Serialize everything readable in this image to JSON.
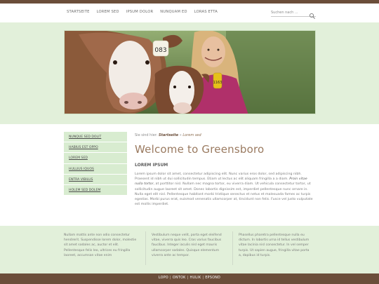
{
  "nav": {
    "items": [
      "STARTSEITE",
      "LOREM SED",
      "IPSUM DOLOR",
      "NUNQUAM ED",
      "LORAS ETTA"
    ]
  },
  "search": {
    "placeholder": "Suchen nach ..."
  },
  "sidebar": {
    "items": [
      "NUNQUE SED DOLIT",
      "HABIUS EST OPPO",
      "LOREM SED",
      "HULLIUS IQUOS",
      "ENTRA VIBILUS",
      "HOLEM SED DOLEM"
    ]
  },
  "breadcrumb": {
    "prefix": "Sie sind hier:",
    "home": "Startseite",
    "separator": "»",
    "current": "Lorem sed"
  },
  "main": {
    "title": "Welcome to Greensboro",
    "subtitle": "LOREM IPSUM",
    "paragraph_1": "Lorem ipsum dolor sit amet, consectetur adipiscing elit. Nunc varius eros dolor, sed adipiscing nibh. Praesent id nibh ut dui sollicitudin tempus. Etiam ut lectus ac elit aliquam fringilla a a diam. ",
    "paragraph_em": "Proin vitae nulla tortor",
    "paragraph_2": ", at porttitor nisl. Nullam nec magna tortor, eu viverra diam. Ut vehicula consectetur tortor, ut sollicitudin augue laoreet sit amet. Donec lobortis dignissim est, imperdiet pellentesque nunc ornare in. Nulla eget elit nisl. Pellentesque habitant morbi tristique senectus et netus et malesuada fames ac turpis egestas. Morbi purus erat, euismod venenatis ullamcorper at, tincidunt non felis. Fusce vel justo vulputate est mollis imperdiet."
  },
  "footer": {
    "col_1": "Nullam mattis ante non odio consectetur hendrerit. Suspendisse lorem dolor, molestie sit amet sodales ac, auctor et elit. Pellentesque felis leo, ultrices eu fringilla laoreet, accumsan vitae enim",
    "col_2": "Vestibulum neque velit, porta eget eleifend vitae, viverra quis leo. Cras varius faucibus faucibus. Integer iaculis nisl eget mauris ullamcorper sodales. Quisque elementum viverra ante ac tempor.",
    "col_3": "Phasellus pharetra pellentesque nulla eu dictum. In lobortis urna id tellus vestibulum vitae lacinia nisl consectetur. In vel semper turpis. Ut sapien augue, fringilla vitae porta a, dapibus id turpis."
  },
  "bottom_links": [
    "LOPO",
    "ONTOK",
    "HULIK",
    "EPSOND"
  ],
  "hero": {
    "ear_tag_1": "083",
    "ear_tag_2": "1163"
  },
  "colors": {
    "brand_brown": "#6b4e3a",
    "light_green": "#e2f0da",
    "sidebar_green": "#d8ecd0",
    "title_brown": "#9a7a60"
  }
}
